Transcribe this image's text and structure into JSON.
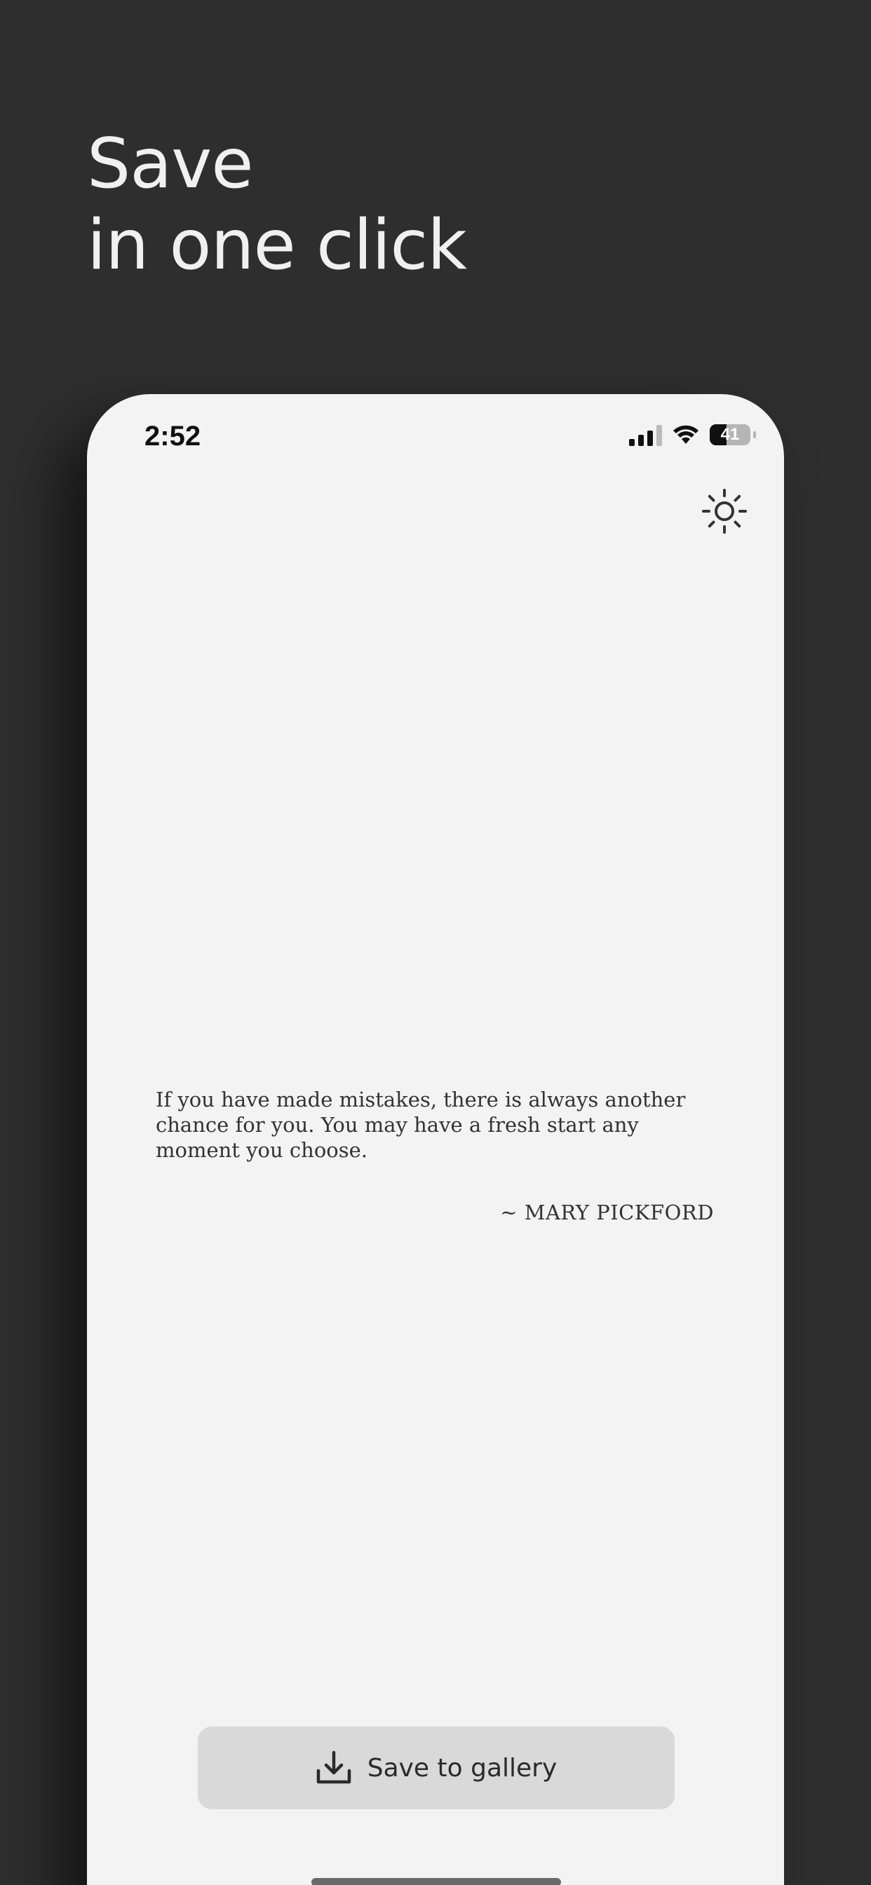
{
  "headline": {
    "line1": "Save",
    "line2": "in one click"
  },
  "device": {
    "status_bar": {
      "time": "2:52",
      "battery": "41",
      "battery_level_percent": 41,
      "signal_icon": "cellular-signal-icon",
      "wifi_icon": "wifi-icon"
    },
    "theme_toggle_icon": "sun-icon",
    "quote": {
      "text": "If you have made mistakes, there is always another chance for you. You may have a fresh start any moment you choose.",
      "author": "~ MARY PICKFORD"
    },
    "save_button": {
      "label": "Save to gallery",
      "icon": "download-icon"
    }
  },
  "colors": {
    "background": "#2e2e2e",
    "headline": "#f0f0f0",
    "screen": "#f3f3f3",
    "button": "#d9d9d9"
  }
}
